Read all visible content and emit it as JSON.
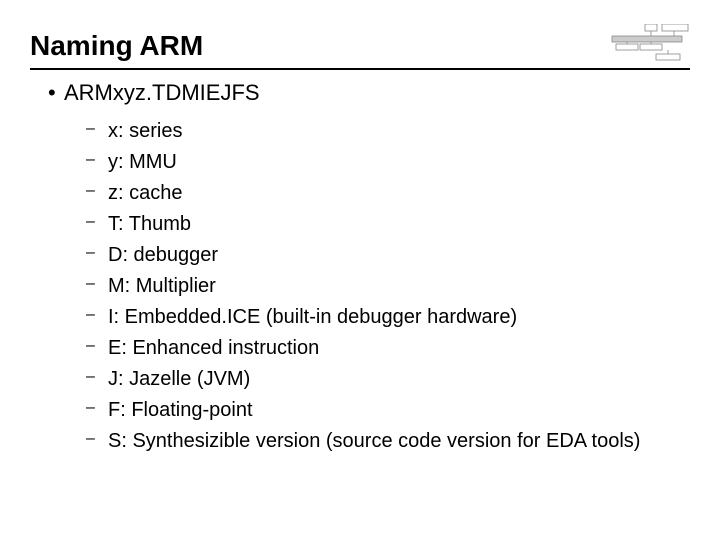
{
  "title": "Naming ARM",
  "heading": "ARMxyz.TDMIEJFS",
  "items": [
    "x: series",
    "y: MMU",
    "z: cache",
    "T: Thumb",
    "D: debugger",
    "M: Multiplier",
    "I: Embedded.ICE (built-in debugger hardware)",
    "E: Enhanced instruction",
    "J: Jazelle (JVM)",
    "F: Floating-point",
    "S: Synthesizible version (source code version for EDA tools)"
  ]
}
